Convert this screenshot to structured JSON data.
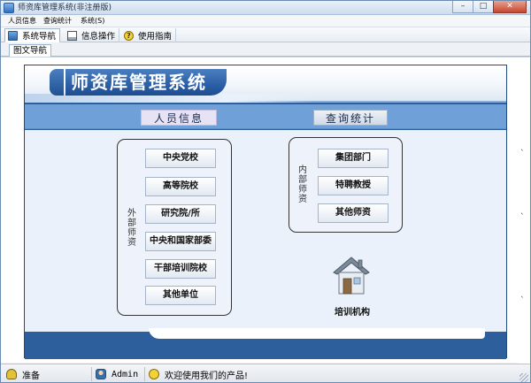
{
  "window": {
    "title": "师资库管理系统(非注册版)",
    "controls": {
      "minimize": "–",
      "maximize": "□",
      "close": "✕"
    }
  },
  "menu": [
    "人员信息",
    "查询统计",
    "系统(S)"
  ],
  "toolbar": {
    "tabs": [
      {
        "label": "系统导航",
        "icon": "navigation-icon",
        "active": true
      },
      {
        "label": "信息操作",
        "icon": "info-icon",
        "active": false
      },
      {
        "label": "使用指南",
        "icon": "help-icon",
        "active": false
      }
    ]
  },
  "subtab": {
    "label": "图文导航"
  },
  "panel": {
    "title": "师资库管理系统",
    "categories": {
      "person": "人员信息",
      "query": "查询统计"
    },
    "external_group": {
      "label": "外部师资",
      "buttons": [
        "中央党校",
        "高等院校",
        "研究院/所",
        "中央和国家部委",
        "干部培训院校",
        "其他单位"
      ]
    },
    "internal_group": {
      "label": "内部师资",
      "buttons": [
        "集团部门",
        "特聘教授",
        "其他师资"
      ]
    },
    "training": {
      "label": "培训机构",
      "icon": "house-icon"
    }
  },
  "statusbar": {
    "ready": "准备",
    "user": "Admin",
    "welcome": "欢迎使用我们的产品!"
  },
  "colors": {
    "panel_blue": "#2d5f9d",
    "category_bar": "#6fa0d8",
    "body_bg": "#eaf1fb"
  }
}
